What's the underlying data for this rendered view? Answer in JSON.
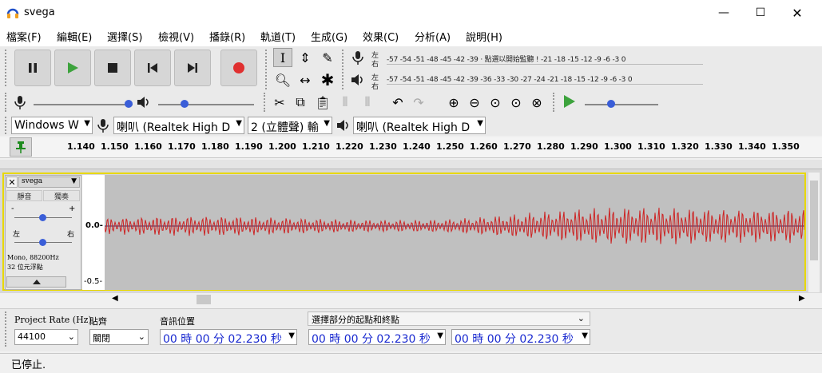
{
  "window": {
    "title": "svega"
  },
  "menu": [
    "檔案(F)",
    "編輯(E)",
    "選擇(S)",
    "檢視(V)",
    "播錄(R)",
    "軌道(T)",
    "生成(G)",
    "效果(C)",
    "分析(A)",
    "說明(H)"
  ],
  "meters": {
    "record_lr": [
      "左",
      "右"
    ],
    "record_scale": "-57 -54 -51 -48 -45 -42 -39 · 點選以開始監聽 ! -21 -18 -15 -12 -9 -6 -3 0",
    "play_lr": [
      "左",
      "右"
    ],
    "play_scale": "-57 -54 -51 -48 -45 -42 -39 -36 -33 -30 -27 -24 -21 -18 -15 -12 -9 -6 -3 0"
  },
  "device_toolbar": {
    "host": "Windows W",
    "recording_device": "喇叭 (Realtek High D",
    "channels": "2 (立體聲) 輸",
    "playback_device": "喇叭 (Realtek High D"
  },
  "ruler": {
    "labels": [
      "1.140",
      "1.150",
      "1.160",
      "1.170",
      "1.180",
      "1.190",
      "1.200",
      "1.210",
      "1.220",
      "1.230",
      "1.240",
      "1.250",
      "1.260",
      "1.270",
      "1.280",
      "1.290",
      "1.300",
      "1.310",
      "1.320",
      "1.330",
      "1.340",
      "1.350"
    ]
  },
  "track": {
    "name": "svega",
    "mute_label": "靜音",
    "solo_label": "獨奏",
    "pan_left": "左",
    "pan_right": "右",
    "gain_minus": "-",
    "gain_plus": "+",
    "info_line1": "Mono, 88200Hz",
    "info_line2": "32 位元浮點",
    "scale_top": "0.0-",
    "scale_bottom": "-0.5-"
  },
  "waveform_color": "#cc2222",
  "selection_toolbar": {
    "project_rate_label": "Project Rate (Hz)",
    "project_rate_value": "44100",
    "snap_label": "貼齊",
    "snap_value": "關閉",
    "audio_position_label": "音訊位置",
    "audio_position_value": "00 時 00 分 02.230 秒",
    "selection_mode": "選擇部分的起點和終點",
    "selection_start": "00 時 00 分 02.230 秒",
    "selection_end": "00 時 00 分 02.230 秒"
  },
  "status": {
    "text": "已停止."
  }
}
